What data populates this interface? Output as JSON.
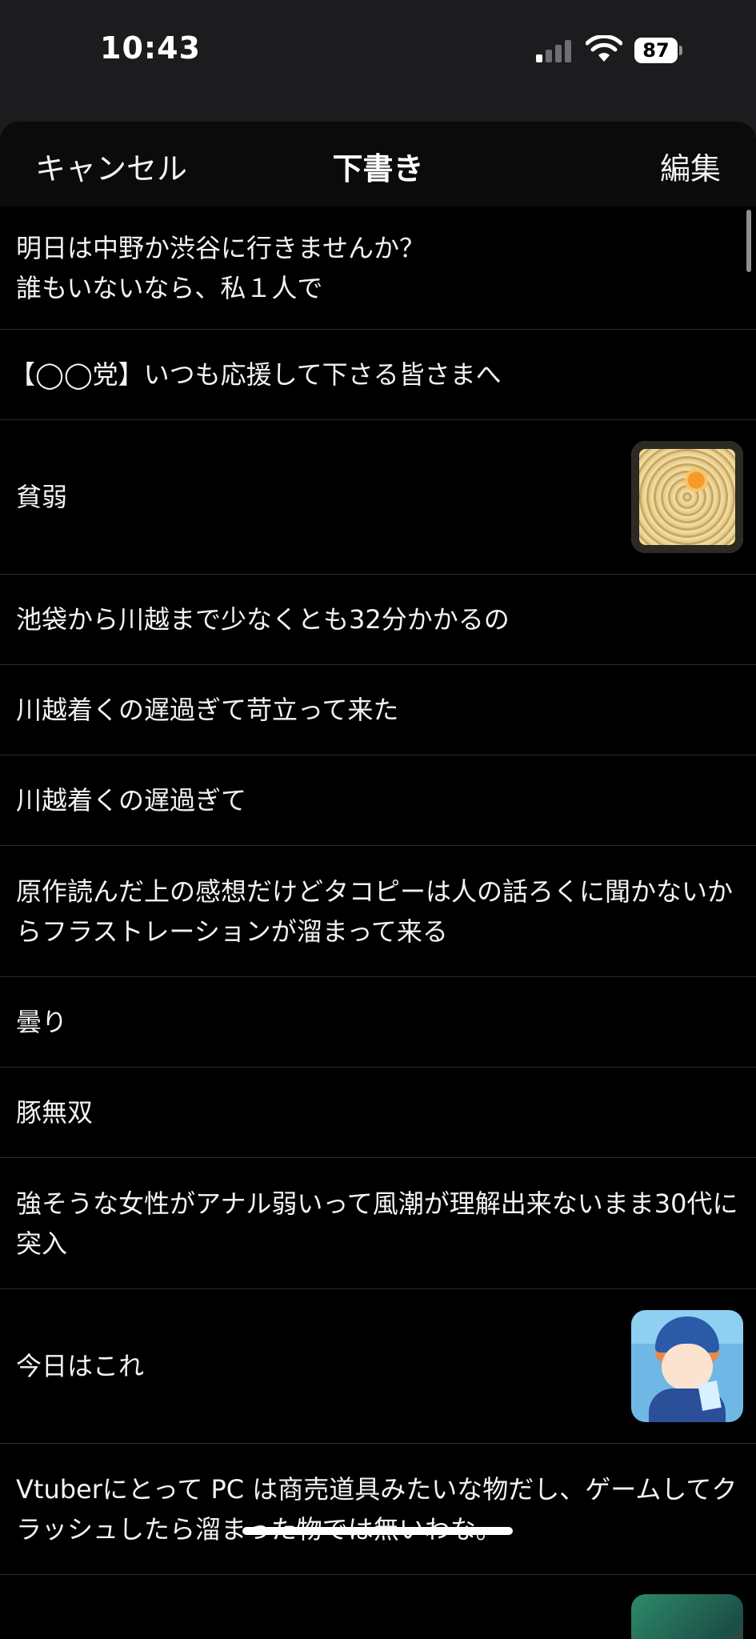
{
  "status_bar": {
    "time": "10:43",
    "battery": "87"
  },
  "nav": {
    "cancel_label": "キャンセル",
    "title": "下書き",
    "edit_label": "編集"
  },
  "drafts": [
    {
      "text": "明日は中野か渋谷に行きませんか？\n誰もいないなら、私１人で"
    },
    {
      "text": "【◯◯党】いつも応援して下さる皆さまへ"
    },
    {
      "text": "貧弱",
      "thumbnail": "noodle-photo"
    },
    {
      "text": "池袋から川越まで少なくとも32分かかるの"
    },
    {
      "text": "川越着くの遅過ぎて苛立って来た"
    },
    {
      "text": "川越着くの遅過ぎて"
    },
    {
      "text": "原作読んだ上の感想だけどタコピーは人の話ろくに聞かないからフラストレーションが溜まって来る"
    },
    {
      "text": "曇り"
    },
    {
      "text": "豚無双"
    },
    {
      "text": "強そうな女性がアナル弱いって風潮が理解出来ないまま30代に突入"
    },
    {
      "text": "今日はこれ",
      "thumbnail": "anime-character-image"
    },
    {
      "text": "Vtuberにとって PC は商売道具みたいな物だし、ゲームしてクラッシュしたら溜まった物では無いわな。"
    },
    {
      "text": "",
      "thumbnail": "partial-image"
    }
  ],
  "colors": {
    "background": "#000000",
    "status_bar": "#1c1c1e",
    "text": "#f2f2f2",
    "separator": "#2c2c2e"
  }
}
